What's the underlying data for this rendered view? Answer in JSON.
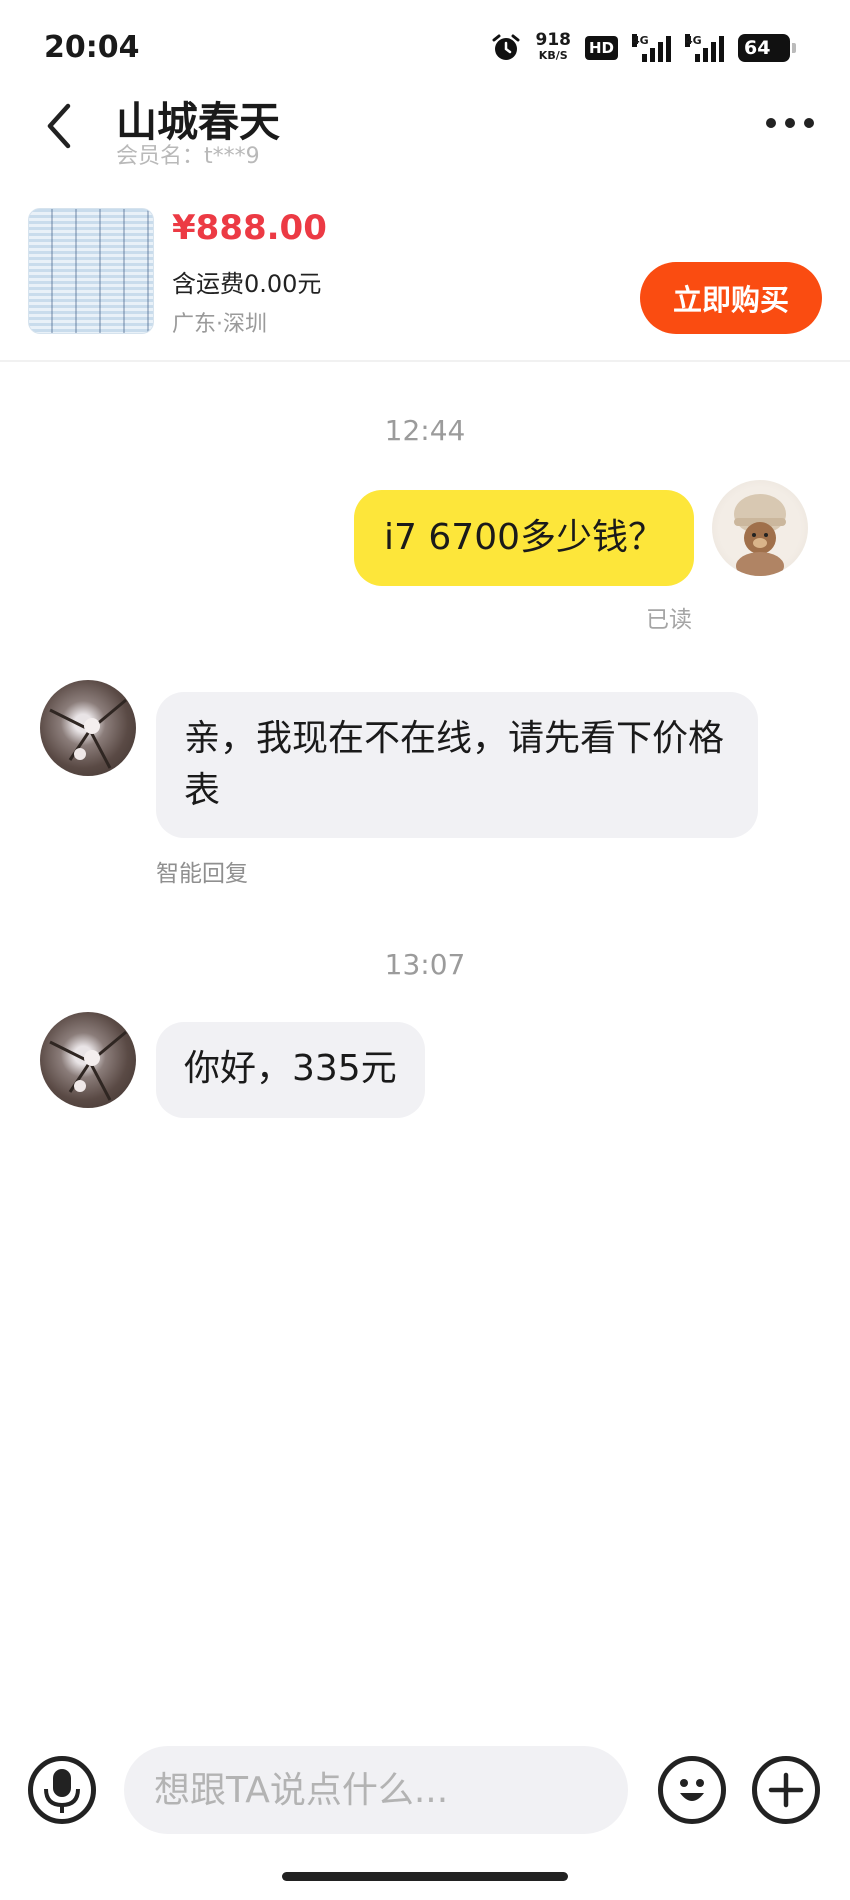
{
  "status_bar": {
    "time": "20:04",
    "net_speed": "918",
    "net_unit": "KB/S",
    "hd_label": "HD",
    "signal_label": "4G",
    "battery": "64"
  },
  "header": {
    "title": "山城春天",
    "subtitle": "会员名：t***9",
    "icons": {
      "back": "back-chevron-icon",
      "more": "more-dots-icon"
    }
  },
  "product": {
    "price": "¥888.00",
    "shipping": "含运费0.00元",
    "location": "广东·深圳",
    "buy_label": "立即购买"
  },
  "chat": {
    "time_1": "12:44",
    "msg_mine": "i7 6700多少钱？",
    "read_status": "已读",
    "msg_auto": "亲，我现在不在线，请先看下价格表",
    "auto_label": "智能回复",
    "time_2": "13:07",
    "msg_reply": "你好，335元"
  },
  "input_bar": {
    "placeholder": "想跟TA说点什么...",
    "icons": {
      "voice": "microphone-icon",
      "emoji": "emoji-icon",
      "more": "plus-icon"
    }
  },
  "colors": {
    "accent": "#fa4c11",
    "price": "#ec3a44",
    "my_bubble": "#fde63a",
    "other_bubble": "#f1f1f4"
  }
}
